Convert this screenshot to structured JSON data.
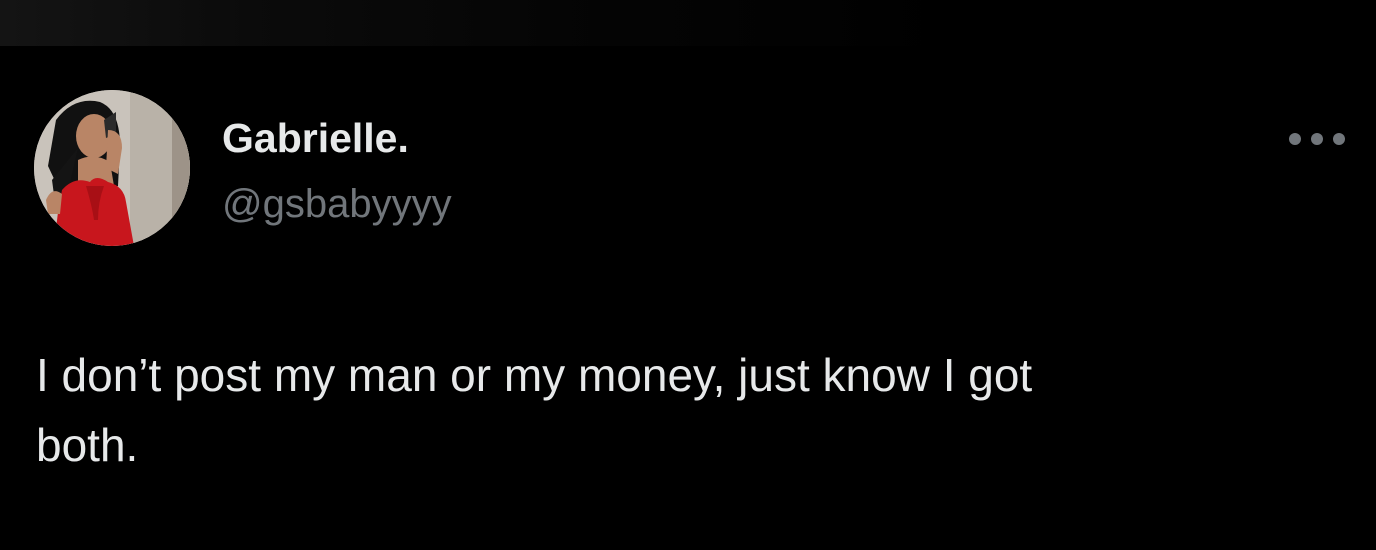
{
  "tweet": {
    "display_name": "Gabrielle.",
    "handle": "@gsbabyyyy",
    "text": "I don’t post my man or my money, just know I got\nboth.",
    "avatar": "profile-photo",
    "more_icon": "more-horizontal-icon"
  },
  "colors": {
    "background": "#000000",
    "primary_text": "#e7e9ea",
    "secondary_text": "#71767b",
    "avatar_dress": "#c8161d"
  }
}
